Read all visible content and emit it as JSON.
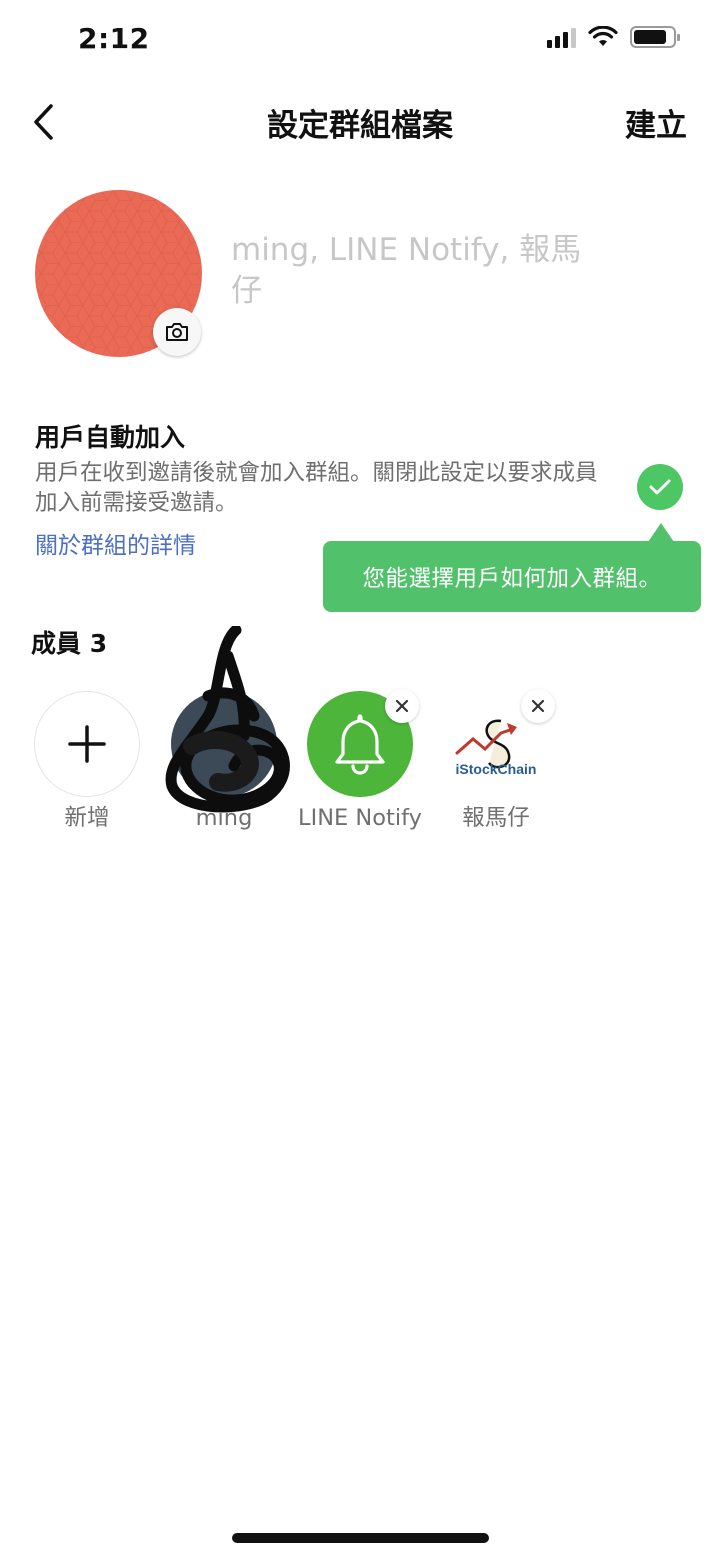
{
  "status_bar": {
    "time": "2:12",
    "battery_level": 0.85
  },
  "nav": {
    "title": "設定群組檔案",
    "create_label": "建立"
  },
  "group_profile": {
    "avatar_color": "#ea6a56",
    "name_placeholder": "ming, LINE Notify, 報馬仔"
  },
  "auto_join": {
    "title": "用戶自動加入",
    "description": "用戶在收到邀請後就會加入群組。關閉此設定以要求成員加入前需接受邀請。",
    "link": "關於群組的詳情",
    "enabled": true,
    "toggle_color": "#4cc764"
  },
  "tooltip": {
    "text": "您能選擇用戶如何加入群組。",
    "color": "#52c16b"
  },
  "members": {
    "title": "成員 3",
    "add_label": "新增",
    "list": [
      {
        "label": "ming",
        "avatar": "photo"
      },
      {
        "label": "LINE Notify",
        "avatar": "bell-icon",
        "color": "#4db53a"
      },
      {
        "label": "報馬仔",
        "avatar": "istockchain-logo",
        "logo_text": "iStockChain"
      }
    ]
  }
}
